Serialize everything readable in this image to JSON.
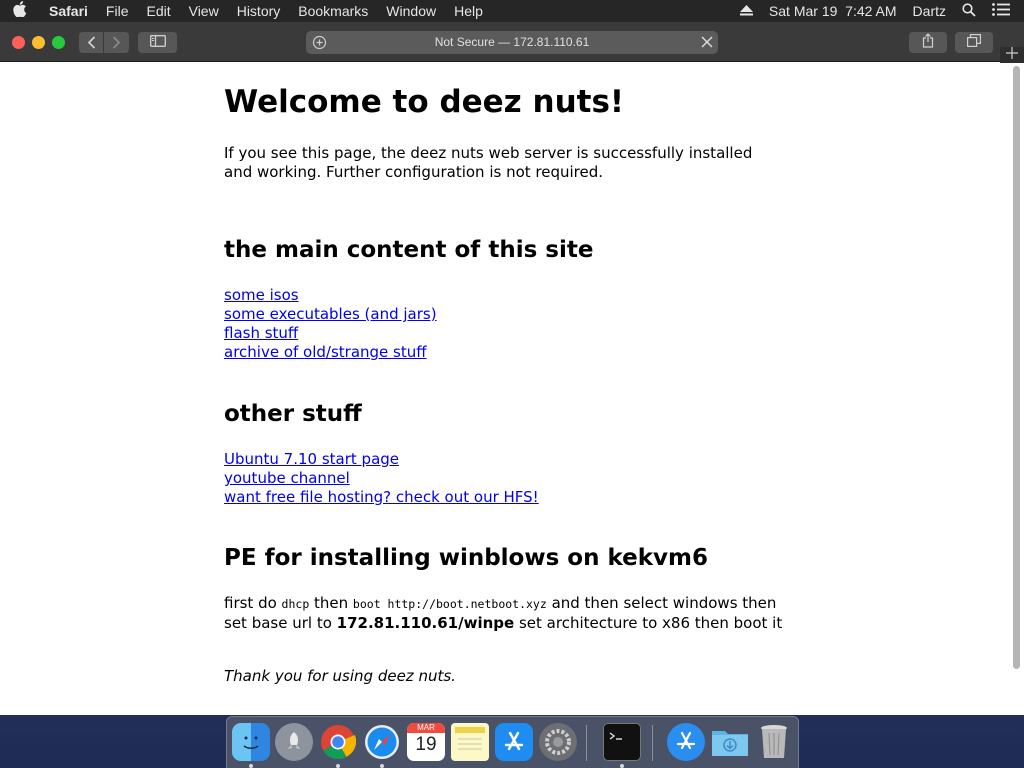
{
  "menubar": {
    "app_name": "Safari",
    "menus": [
      "File",
      "Edit",
      "View",
      "History",
      "Bookmarks",
      "Window",
      "Help"
    ],
    "datetime": "Sat Mar 19  7:42 AM",
    "user": "Dartz"
  },
  "browser": {
    "address": "Not Secure — 172.81.110.61"
  },
  "page": {
    "title": "Welcome to deez nuts!",
    "intro": "If you see this page, the deez nuts web server is successfully installed and working. Further configuration is not required.",
    "section_main": {
      "heading": "the main content of this site",
      "links": [
        "some isos",
        "some executables (and jars)",
        "flash stuff",
        "archive of old/strange stuff"
      ]
    },
    "section_other": {
      "heading": "other stuff",
      "links": [
        "Ubuntu 7.10 start page",
        "youtube channel",
        "want free file hosting? check out our HFS!"
      ]
    },
    "section_pe": {
      "heading": "PE for installing winblows on kekvm6",
      "text_1": "first do ",
      "code_1": "dhcp",
      "text_2": " then ",
      "code_2": "boot http://boot.netboot.xyz",
      "text_3": " and then select windows then set base url to ",
      "bold_url": "172.81.110.61/winpe",
      "text_4": " set architecture to x86 then boot it"
    },
    "thanks": "Thank you for using deez nuts."
  },
  "dock": {
    "calendar_month": "MAR",
    "calendar_day": "19",
    "apps": [
      "finder-icon",
      "launchpad-icon",
      "chrome-icon",
      "safari-icon",
      "calendar-icon",
      "notes-icon",
      "app-store-icon",
      "system-preferences-icon",
      "terminal-icon",
      "applications-folder-icon",
      "downloads-folder-icon",
      "trash-icon"
    ]
  },
  "colors": {
    "link": "#0000ee",
    "menubar_bg": "#262626",
    "toolbar_bg": "#3a3a3a"
  }
}
